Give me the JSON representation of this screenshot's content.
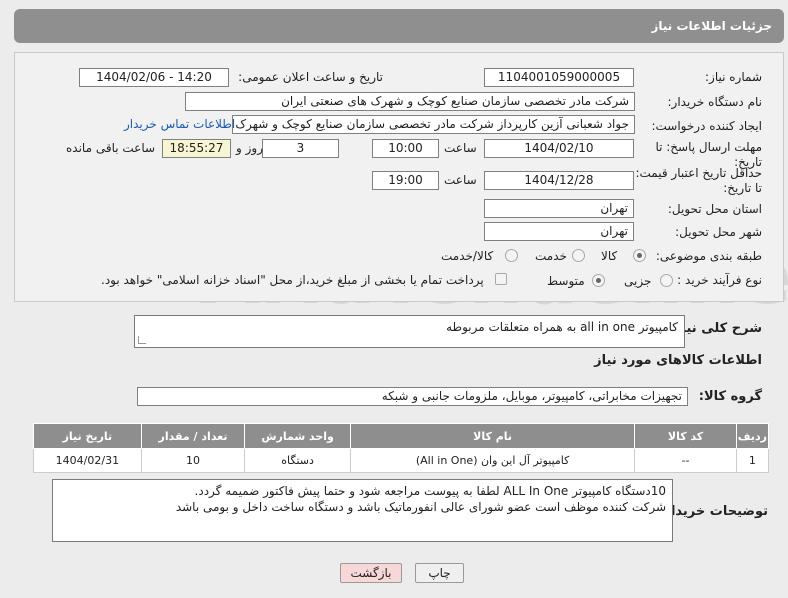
{
  "header": {
    "title": "جزئیات اطلاعات نیاز"
  },
  "fields": {
    "need_number_label": "شماره نیاز:",
    "need_number": "1104001059000005",
    "announce_label": "تاریخ و ساعت اعلان عمومی:",
    "announce_value": "1404/02/06 - 14:20",
    "buyer_label": "نام دستگاه خریدار:",
    "buyer_value": "شرکت مادر تخصصی سازمان صنایع کوچک و شهرک های صنعتی ایران",
    "creator_label": "ایجاد کننده درخواست:",
    "creator_value": "جواد  شعبانی آزین کارپرداز  شرکت مادر تخصصی سازمان صنایع کوچک و شهرک",
    "contact_link": "اطلاعات تماس خریدار",
    "deadline_label": "مهلت ارسال پاسخ: تا تاریخ:",
    "deadline_date": "1404/02/10",
    "time_label": "ساعت",
    "deadline_time": "10:00",
    "days_value": "3",
    "days_label": "روز و",
    "remaining_time": "18:55:27",
    "remaining_label": "ساعت باقی مانده",
    "price_label": "حداقل تاریخ اعتبار قیمت: تا تاریخ:",
    "price_date": "1404/12/28",
    "price_time": "19:00",
    "province_label": "استان محل تحویل:",
    "province_value": "تهران",
    "city_label": "شهر محل تحویل:",
    "city_value": "تهران",
    "category_label": "طبقه بندی موضوعی:",
    "category_options": [
      "کالا",
      "خدمت",
      "کالا/خدمت"
    ],
    "process_label": "نوع فرآیند خرید :",
    "process_options": [
      "جزیی",
      "متوسط"
    ],
    "payment_note": "پرداخت تمام یا بخشی از مبلغ خرید،از محل \"اسناد خزانه اسلامی\" خواهد بود."
  },
  "summary": {
    "label": "شرح کلی نیاز:",
    "value": "کامپیوتر all in one به همراه متعلقات مربوطه"
  },
  "goods_section": {
    "title": "اطلاعات کالاهای مورد نیاز"
  },
  "goods_group": {
    "label": "گروه کالا:",
    "value": "تجهیزات مخابراتی، کامپیوتر، موبایل، ملزومات جانبی و شبکه"
  },
  "table": {
    "headers": [
      "ردیف",
      "کد کالا",
      "نام کالا",
      "واحد شمارش",
      "تعداد / مقدار",
      "تاریخ نیاز"
    ],
    "rows": [
      [
        "1",
        "--",
        "کامپیوتر آل این وان (All in One)",
        "دستگاه",
        "10",
        "1404/02/31"
      ]
    ]
  },
  "buyer_notes": {
    "label": "توضیحات خریدار:",
    "line1": "10دستگاه کامپیوتر ALL In One لطفا به پیوست مراجعه شود و حتما پیش فاکتور ضمیمه گردد.",
    "line2": "شرکت کننده موظف است عضو شورای عالی انفورماتیک باشد و دستگاه ساخت داخل و بومی باشد"
  },
  "buttons": {
    "print": "چاپ",
    "back": "بازگشت"
  },
  "watermark": {
    "text": "AriaTender.neT"
  },
  "colors": {
    "header_bg": "#8f8f8f",
    "link": "#1a5bb5",
    "back_button": "#f7d8d8"
  }
}
